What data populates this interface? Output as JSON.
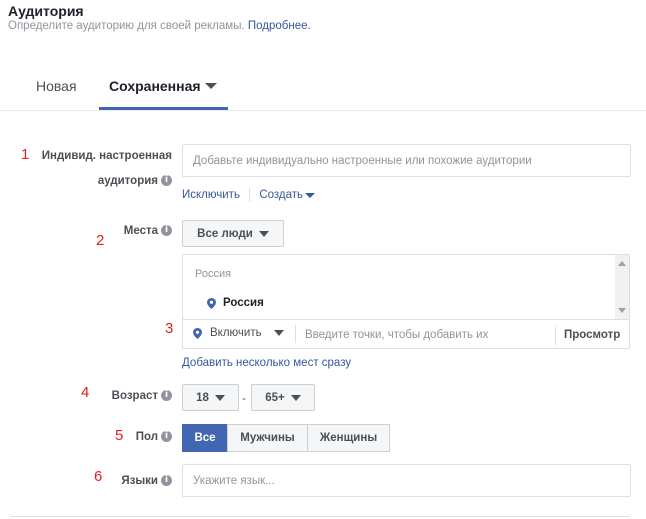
{
  "header": {
    "title": "Аудитория",
    "subtitle": "Определите аудиторию для своей рекламы.",
    "more_link": "Подробнее."
  },
  "tabs": [
    {
      "label": "Новая",
      "active": false
    },
    {
      "label": "Сохраненная",
      "active": true
    }
  ],
  "annotations": [
    "1",
    "2",
    "3",
    "4",
    "5",
    "6"
  ],
  "custom_audience": {
    "label_line1": "Индивид. настроенная",
    "label_line2": "аудитория",
    "placeholder": "Добавьте индивидуально настроенные или похожие аудитории",
    "exclude_link": "Исключить",
    "create_link": "Создать"
  },
  "locations": {
    "label": "Места",
    "people_dropdown": "Все люди",
    "group_header": "Россия",
    "selected_item": "Россия",
    "include_dropdown": "Включить",
    "search_placeholder": "Введите точки, чтобы добавить их",
    "browse_button": "Просмотр",
    "bulk_link": "Добавить несколько мест сразу"
  },
  "age": {
    "label": "Возраст",
    "min": "18",
    "separator": "-",
    "max": "65+"
  },
  "gender": {
    "label": "Пол",
    "options": [
      "Все",
      "Мужчины",
      "Женщины"
    ],
    "selected": "Все"
  },
  "languages": {
    "label": "Языки",
    "placeholder": "Укажите язык..."
  },
  "colors": {
    "accent": "#4267b2",
    "link": "#365899",
    "annotation": "#e02020"
  },
  "icons": [
    "info-icon",
    "location-pin-icon",
    "chevron-down-icon"
  ]
}
